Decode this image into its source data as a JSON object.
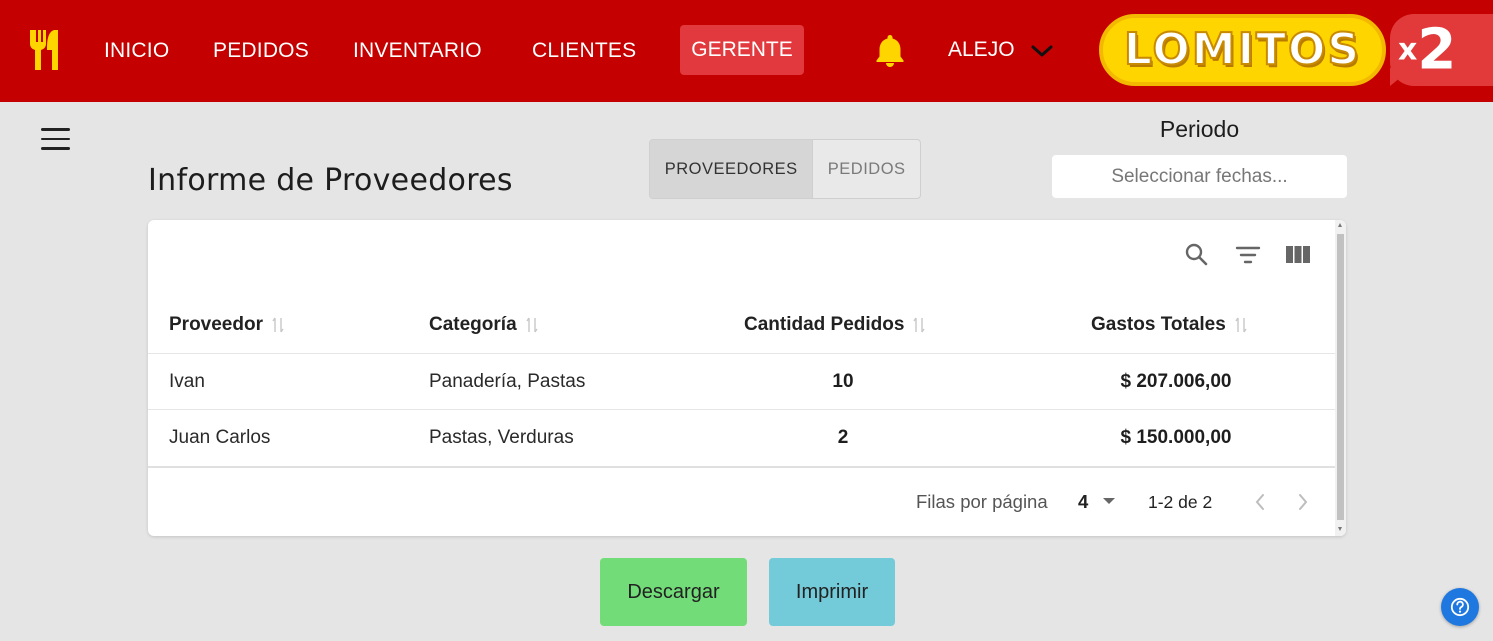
{
  "nav": {
    "items": [
      {
        "label": "INICIO"
      },
      {
        "label": "PEDIDOS"
      },
      {
        "label": "INVENTARIO"
      },
      {
        "label": "CLIENTES"
      }
    ],
    "active_label": "GERENTE",
    "user": "ALEJO",
    "icons": {
      "brand": "fork-knife-icon",
      "notifications": "bell-icon",
      "user_menu": "chevron-down-icon"
    },
    "colors": {
      "bar": "#c40000",
      "active_bg": "#e1393d",
      "bell": "#ffd500"
    }
  },
  "logo": {
    "text": "LOMITOS",
    "suffix_x": "x",
    "suffix_num": "2",
    "pill_color": "#ffd500",
    "bubble_color": "#e23a3a"
  },
  "menu": {
    "icon": "hamburger-icon"
  },
  "page": {
    "title": "Informe de Proveedores"
  },
  "view_toggle": {
    "options": [
      {
        "label": "PROVEEDORES",
        "selected": true
      },
      {
        "label": "PEDIDOS",
        "selected": false
      }
    ]
  },
  "period": {
    "label": "Periodo",
    "placeholder": "Seleccionar fechas..."
  },
  "table": {
    "toolbar_icons": [
      "search-icon",
      "filter-icon",
      "columns-icon"
    ],
    "columns": [
      {
        "label": "Proveedor"
      },
      {
        "label": "Categoría"
      },
      {
        "label": "Cantidad Pedidos"
      },
      {
        "label": "Gastos Totales"
      }
    ],
    "rows": [
      {
        "proveedor": "Ivan",
        "categoria": "Panadería, Pastas",
        "cantidad": "10",
        "gastos": "$ 207.006,00"
      },
      {
        "proveedor": "Juan Carlos",
        "categoria": "Pastas, Verduras",
        "cantidad": "2",
        "gastos": "$ 150.000,00"
      }
    ],
    "pagination": {
      "rows_per_page_label": "Filas por página",
      "rows_per_page": "4",
      "range": "1-2 de 2"
    }
  },
  "actions": {
    "download": "Descargar",
    "print": "Imprimir",
    "download_color": "#72dc78",
    "print_color": "#73cad8"
  },
  "help": {
    "icon": "help-icon",
    "color": "#1f78e0"
  }
}
